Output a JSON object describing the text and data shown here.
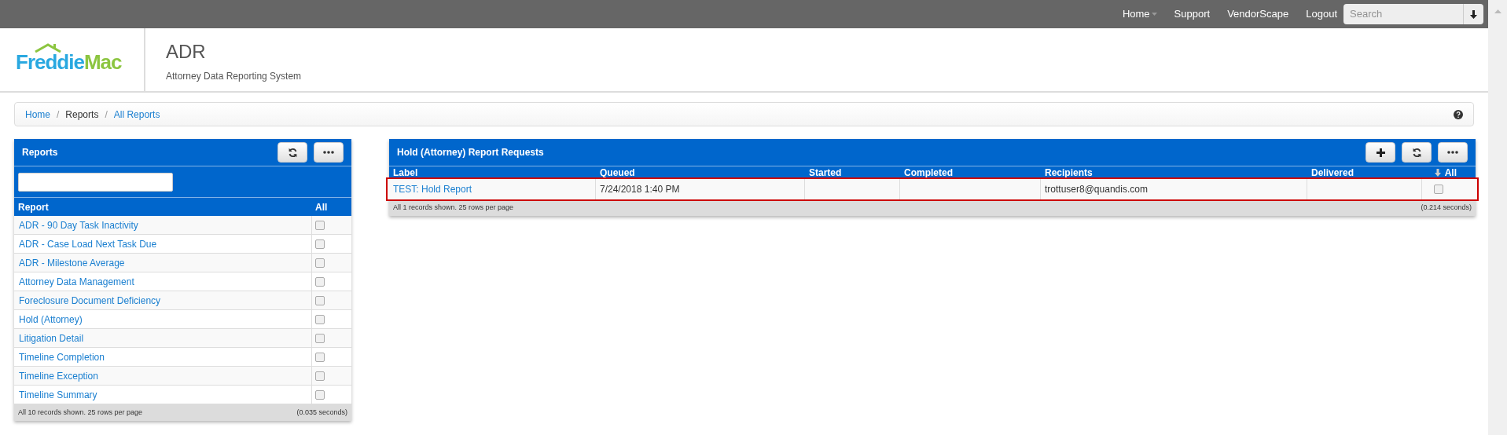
{
  "topnav": {
    "links": [
      {
        "label": "Home",
        "dropdown": true
      },
      {
        "label": "Support",
        "dropdown": false
      },
      {
        "label": "VendorScape",
        "dropdown": false
      },
      {
        "label": "Logout",
        "dropdown": false
      }
    ],
    "search": {
      "placeholder": "Search"
    }
  },
  "header": {
    "logo": {
      "part1": "Freddie",
      "part2": "Mac"
    },
    "title": "ADR",
    "subtitle": "Attorney Data Reporting System"
  },
  "breadcrumb_separator": "/",
  "breadcrumb": [
    {
      "label": "Home",
      "link": true
    },
    {
      "label": "Reports",
      "link": false
    },
    {
      "label": "All Reports",
      "link": true
    }
  ],
  "reports_panel": {
    "title": "Reports",
    "columns": [
      "Report",
      "All"
    ],
    "rows": [
      {
        "label": "ADR - 90 Day Task Inactivity",
        "checked": false
      },
      {
        "label": "ADR - Case Load Next Task Due",
        "checked": false
      },
      {
        "label": "ADR - Milestone Average",
        "checked": false
      },
      {
        "label": "Attorney Data Management",
        "checked": false
      },
      {
        "label": "Foreclosure Document Deficiency",
        "checked": false
      },
      {
        "label": "Hold (Attorney)",
        "checked": false
      },
      {
        "label": "Litigation Detail",
        "checked": false
      },
      {
        "label": "Timeline Completion",
        "checked": false
      },
      {
        "label": "Timeline Exception",
        "checked": false
      },
      {
        "label": "Timeline Summary",
        "checked": false
      }
    ],
    "footer": "All 10 records shown. 25 rows per page",
    "timing": "(0.035 seconds)"
  },
  "requests_panel": {
    "title": "Hold (Attorney) Report Requests",
    "columns": [
      "Label",
      "Queued",
      "Started",
      "Completed",
      "Recipients",
      "Delivered",
      "All"
    ],
    "rows": [
      {
        "label": "TEST: Hold Report",
        "queued": "7/24/2018 1:40 PM",
        "recipients": "trottuser8@quandis.com",
        "checked": false,
        "selected": true
      }
    ],
    "footer": "All 1 records shown. 25 rows per page",
    "timing": "(0.214 seconds)"
  }
}
